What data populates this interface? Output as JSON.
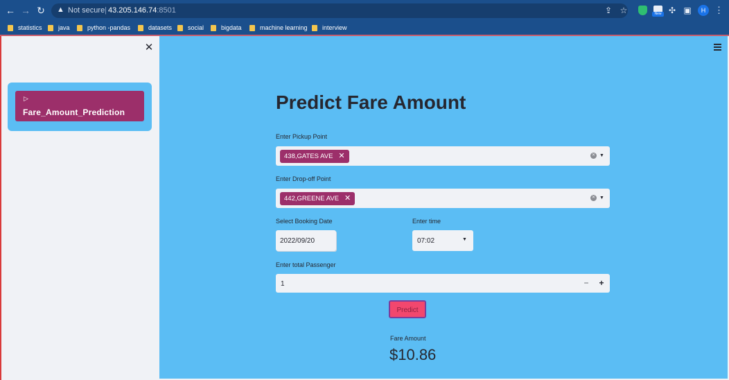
{
  "browser": {
    "security_text": "Not secure",
    "url_host": "43.205.146.74",
    "url_port": ":8501",
    "profile_initial": "H",
    "extension_badge": "New",
    "icons": [
      "back-icon",
      "forward-icon",
      "reload-icon",
      "warning-icon",
      "share-icon",
      "star-icon",
      "shield-extension-icon",
      "new-extension-icon",
      "puzzle-icon",
      "sidepanel-icon",
      "profile-avatar",
      "kebab-menu-icon"
    ]
  },
  "bookmarks": [
    {
      "label": "statistics"
    },
    {
      "label": "java"
    },
    {
      "label": "python -pandas"
    },
    {
      "label": "datasets"
    },
    {
      "label": "social"
    },
    {
      "label": "bigdata"
    },
    {
      "label": "machine learning"
    },
    {
      "label": "interview"
    }
  ],
  "sidebar": {
    "close_icon": "close-icon",
    "nav_items": [
      {
        "label": "Fare_Amount_Prediction"
      }
    ]
  },
  "main": {
    "title": "Predict Fare Amount",
    "pickup": {
      "label": "Enter Pickup Point",
      "selected": "438,GATES AVE"
    },
    "dropoff": {
      "label": "Enter Drop-off Point",
      "selected": "442,GREENE AVE"
    },
    "booking_date": {
      "label": "Select Booking Date",
      "value": "2022/09/20"
    },
    "time": {
      "label": "Enter time",
      "value": "07:02"
    },
    "passengers": {
      "label": "Enter total Passenger",
      "value": "1",
      "minus": "−",
      "plus": "+"
    },
    "predict_label": "Predict",
    "result": {
      "label": "Fare Amount",
      "value": "$10.86"
    }
  },
  "colors": {
    "main_bg": "#5bbdf4",
    "sidebar_bg": "#f0f2f6",
    "chip": "#9c2f6a",
    "primary_button": "#f2476e",
    "browser_chrome": "#1b4f8c"
  }
}
